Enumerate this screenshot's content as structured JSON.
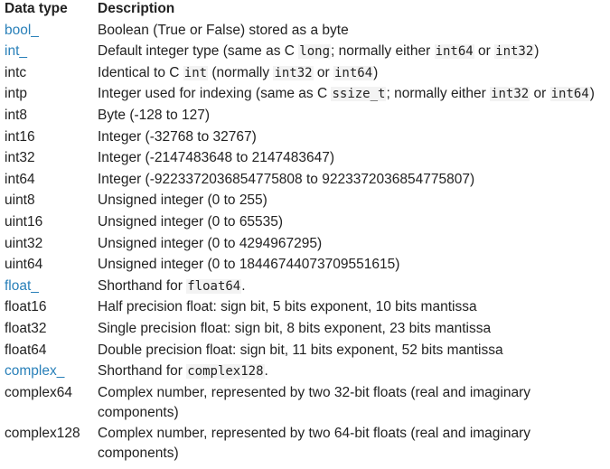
{
  "table": {
    "headers": {
      "type": "Data type",
      "description": "Description"
    },
    "rows": [
      {
        "type": "bool_",
        "link": true,
        "parts": [
          {
            "t": "Boolean (True or False) stored as a byte"
          }
        ]
      },
      {
        "type": "int_",
        "link": true,
        "parts": [
          {
            "t": "Default integer type (same as C "
          },
          {
            "t": "long",
            "code": true
          },
          {
            "t": "; normally either "
          },
          {
            "t": "int64",
            "code": true
          },
          {
            "t": " or "
          },
          {
            "t": "int32",
            "code": true
          },
          {
            "t": ")"
          }
        ]
      },
      {
        "type": "intc",
        "link": false,
        "parts": [
          {
            "t": "Identical to C "
          },
          {
            "t": "int",
            "code": true
          },
          {
            "t": " (normally "
          },
          {
            "t": "int32",
            "code": true
          },
          {
            "t": " or "
          },
          {
            "t": "int64",
            "code": true
          },
          {
            "t": ")"
          }
        ]
      },
      {
        "type": "intp",
        "link": false,
        "parts": [
          {
            "t": "Integer used for indexing (same as C "
          },
          {
            "t": "ssize_t",
            "code": true
          },
          {
            "t": "; normally either "
          },
          {
            "t": "int32",
            "code": true
          },
          {
            "t": " or "
          },
          {
            "t": "int64",
            "code": true
          },
          {
            "t": ")"
          }
        ]
      },
      {
        "type": "int8",
        "link": false,
        "parts": [
          {
            "t": "Byte (-128 to 127)"
          }
        ]
      },
      {
        "type": "int16",
        "link": false,
        "parts": [
          {
            "t": "Integer (-32768 to 32767)"
          }
        ]
      },
      {
        "type": "int32",
        "link": false,
        "parts": [
          {
            "t": "Integer (-2147483648 to 2147483647)"
          }
        ]
      },
      {
        "type": "int64",
        "link": false,
        "parts": [
          {
            "t": "Integer (-9223372036854775808 to 9223372036854775807)"
          }
        ]
      },
      {
        "type": "uint8",
        "link": false,
        "parts": [
          {
            "t": "Unsigned integer (0 to 255)"
          }
        ]
      },
      {
        "type": "uint16",
        "link": false,
        "parts": [
          {
            "t": "Unsigned integer (0 to 65535)"
          }
        ]
      },
      {
        "type": "uint32",
        "link": false,
        "parts": [
          {
            "t": "Unsigned integer (0 to 4294967295)"
          }
        ]
      },
      {
        "type": "uint64",
        "link": false,
        "parts": [
          {
            "t": "Unsigned integer (0 to 18446744073709551615)"
          }
        ]
      },
      {
        "type": "float_",
        "link": true,
        "parts": [
          {
            "t": "Shorthand for "
          },
          {
            "t": "float64",
            "code": true
          },
          {
            "t": "."
          }
        ]
      },
      {
        "type": "float16",
        "link": false,
        "parts": [
          {
            "t": "Half precision float: sign bit, 5 bits exponent, 10 bits mantissa"
          }
        ]
      },
      {
        "type": "float32",
        "link": false,
        "parts": [
          {
            "t": "Single precision float: sign bit, 8 bits exponent, 23 bits mantissa"
          }
        ]
      },
      {
        "type": "float64",
        "link": false,
        "parts": [
          {
            "t": "Double precision float: sign bit, 11 bits exponent, 52 bits mantissa"
          }
        ]
      },
      {
        "type": "complex_",
        "link": true,
        "parts": [
          {
            "t": "Shorthand for "
          },
          {
            "t": "complex128",
            "code": true
          },
          {
            "t": "."
          }
        ]
      },
      {
        "type": "complex64",
        "link": false,
        "tall": true,
        "parts": [
          {
            "t": "Complex number, represented by two 32-bit floats (real and imaginary components)"
          }
        ]
      },
      {
        "type": "complex128",
        "link": false,
        "tall": true,
        "parts": [
          {
            "t": "Complex number, represented by two 64-bit floats (real and imaginary components)"
          }
        ]
      }
    ]
  },
  "colors": {
    "link": "#2980b9",
    "text": "#222222",
    "code_bg": "#f3f3f3"
  }
}
